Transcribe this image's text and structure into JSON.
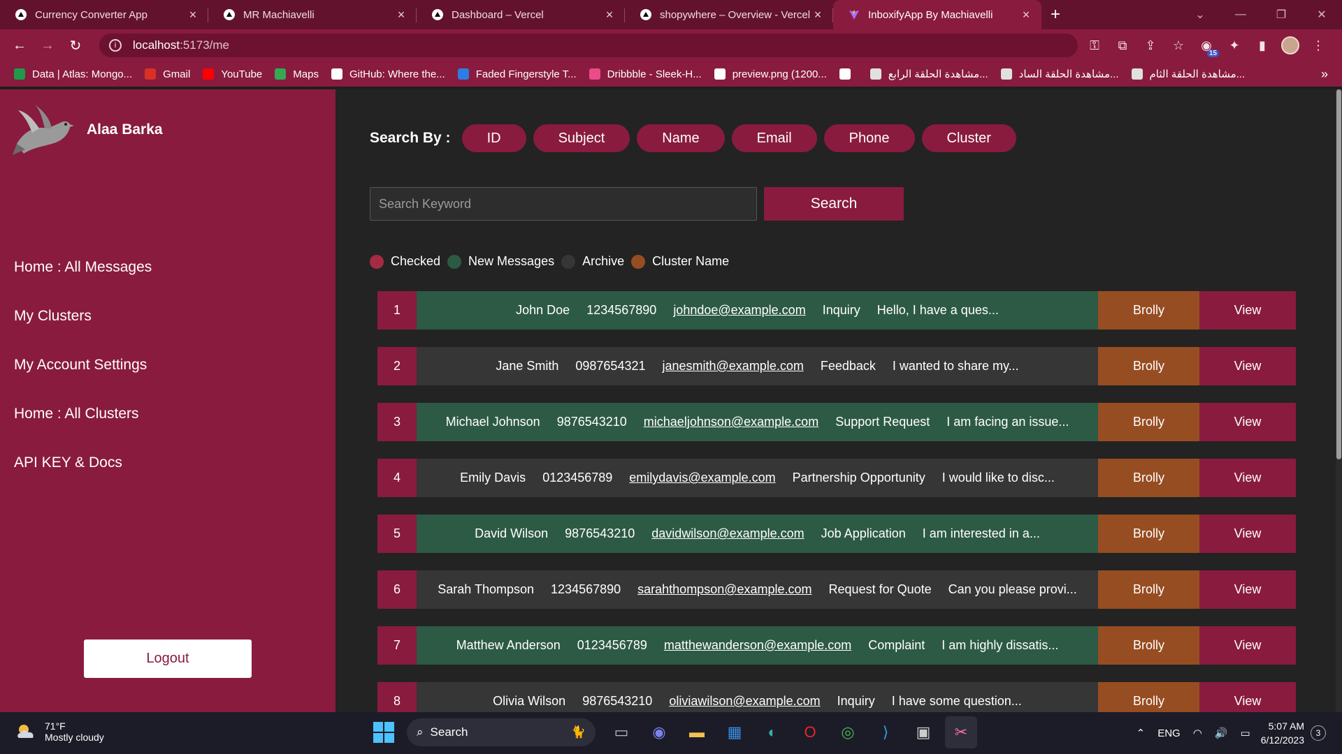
{
  "browser": {
    "tabs": [
      {
        "title": "Currency Converter App",
        "icon": "vercel-triangle-icon",
        "active": false
      },
      {
        "title": "MR Machiavelli",
        "icon": "vercel-triangle-icon",
        "active": false
      },
      {
        "title": "Dashboard – Vercel",
        "icon": "vercel-triangle-icon",
        "active": false
      },
      {
        "title": "shopywhere – Overview - Vercel",
        "icon": "vercel-triangle-icon",
        "active": false
      },
      {
        "title": "InboxifyApp By Machiavelli",
        "icon": "vite-icon",
        "active": true
      }
    ],
    "address": {
      "host": "localhost",
      "path": ":5173/me"
    },
    "extension_badge": "15",
    "bookmarks": [
      {
        "label": "Data | Atlas: Mongo...",
        "color": "#1f9a4a"
      },
      {
        "label": "Gmail",
        "color": "#d93025"
      },
      {
        "label": "YouTube",
        "color": "#ff0000"
      },
      {
        "label": "Maps",
        "color": "#34a853"
      },
      {
        "label": "GitHub: Where the...",
        "color": "#ffffff"
      },
      {
        "label": "Faded Fingerstyle T...",
        "color": "#2f7de1"
      },
      {
        "label": "Dribbble - Sleek-H...",
        "color": "#ea4c89"
      },
      {
        "label": "preview.png (1200...",
        "color": "#ffffff"
      },
      {
        "label": "",
        "color": "#ffffff"
      },
      {
        "label": "مشاهدة الحلقة الرابع...",
        "color": "#e0e0e0"
      },
      {
        "label": "مشاهدة الحلقة الساد...",
        "color": "#e0e0e0"
      },
      {
        "label": "مشاهدة الحلقة الثام...",
        "color": "#e0e0e0"
      }
    ],
    "bookmarks_more": "»"
  },
  "sidebar": {
    "user_name": "Alaa Barka",
    "nav": [
      "Home : All Messages",
      "My Clusters",
      "My Account Settings",
      "Home : All Clusters",
      "API KEY & Docs"
    ],
    "logout_label": "Logout"
  },
  "search": {
    "label": "Search By :",
    "filters": [
      "ID",
      "Subject",
      "Name",
      "Email",
      "Phone",
      "Cluster"
    ],
    "placeholder": "Search Keyword",
    "value": "",
    "button_label": "Search"
  },
  "legend": [
    {
      "label": "Checked",
      "color": "#a52b44"
    },
    {
      "label": "New Messages",
      "color": "#2d5a45"
    },
    {
      "label": "Archive",
      "color": "#363636"
    },
    {
      "label": "Cluster Name",
      "color": "#974d22"
    }
  ],
  "messages": [
    {
      "id": "1",
      "name": "John Doe",
      "phone": "1234567890",
      "email": "johndoe@example.com",
      "subject": "Inquiry",
      "preview": "Hello, I have a ques...",
      "cluster": "Brolly",
      "action": "View",
      "status": "new"
    },
    {
      "id": "2",
      "name": "Jane Smith",
      "phone": "0987654321",
      "email": "janesmith@example.com",
      "subject": "Feedback",
      "preview": "I wanted to share my...",
      "cluster": "Brolly",
      "action": "View",
      "status": "archive"
    },
    {
      "id": "3",
      "name": "Michael Johnson",
      "phone": "9876543210",
      "email": "michaeljohnson@example.com",
      "subject": "Support Request",
      "preview": "I am facing an issue...",
      "cluster": "Brolly",
      "action": "View",
      "status": "new"
    },
    {
      "id": "4",
      "name": "Emily Davis",
      "phone": "0123456789",
      "email": "emilydavis@example.com",
      "subject": "Partnership Opportunity",
      "preview": "I would like to disc...",
      "cluster": "Brolly",
      "action": "View",
      "status": "archive"
    },
    {
      "id": "5",
      "name": "David Wilson",
      "phone": "9876543210",
      "email": "davidwilson@example.com",
      "subject": "Job Application",
      "preview": "I am interested in a...",
      "cluster": "Brolly",
      "action": "View",
      "status": "new"
    },
    {
      "id": "6",
      "name": "Sarah Thompson",
      "phone": "1234567890",
      "email": "sarahthompson@example.com",
      "subject": "Request for Quote",
      "preview": "Can you please provi...",
      "cluster": "Brolly",
      "action": "View",
      "status": "archive"
    },
    {
      "id": "7",
      "name": "Matthew Anderson",
      "phone": "0123456789",
      "email": "matthewanderson@example.com",
      "subject": "Complaint",
      "preview": "I am highly dissatis...",
      "cluster": "Brolly",
      "action": "View",
      "status": "new"
    },
    {
      "id": "8",
      "name": "Olivia Wilson",
      "phone": "9876543210",
      "email": "oliviawilson@example.com",
      "subject": "Inquiry",
      "preview": "I have some question...",
      "cluster": "Brolly",
      "action": "View",
      "status": "archive"
    }
  ],
  "taskbar": {
    "weather_temp": "71°F",
    "weather_desc": "Mostly cloudy",
    "search_label": "Search",
    "language": "ENG",
    "time": "5:07 AM",
    "date": "6/12/2023",
    "notifications": "3"
  }
}
